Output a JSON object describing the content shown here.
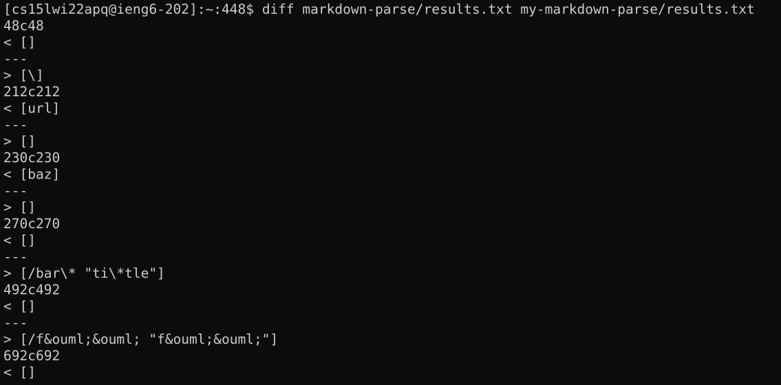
{
  "terminal": {
    "prompt": "[cs15lwi22apq@ieng6-202]:~:448$ ",
    "command": "diff markdown-parse/results.txt my-markdown-parse/results.txt",
    "output_lines": [
      "48c48",
      "< []",
      "---",
      "> [\\]",
      "212c212",
      "< [url]",
      "---",
      "> []",
      "230c230",
      "< [baz]",
      "---",
      "> []",
      "270c270",
      "< []",
      "---",
      "> [/bar\\* \"ti\\*tle\"]",
      "492c492",
      "< []",
      "---",
      "> [/f&ouml;&ouml; \"f&ouml;&ouml;\"]",
      "692c692",
      "< []"
    ]
  },
  "colors": {
    "background": "#0c0c0c",
    "foreground": "#cccccc"
  }
}
